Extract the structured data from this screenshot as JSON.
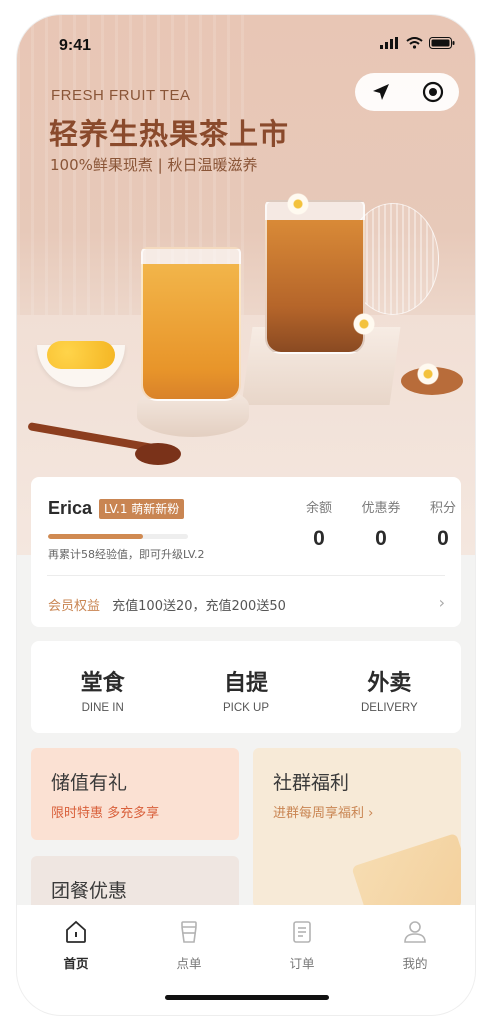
{
  "status": {
    "time": "9:41"
  },
  "hero": {
    "en_title": "FRESH FRUIT TEA",
    "title": "轻养生热果茶上市",
    "subtitle": "100%鲜果现煮 | 秋日温暖滋养"
  },
  "member": {
    "name": "Erica",
    "level": "LV.1 萌新新粉",
    "progress": 0.68,
    "hint": "再累计58经验值，即可升级LV.2",
    "stats": [
      {
        "label": "余额",
        "value": "0"
      },
      {
        "label": "优惠券",
        "value": "0"
      },
      {
        "label": "积分",
        "value": "0"
      }
    ],
    "perk_tag": "会员权益",
    "perk_text": "充值100送20，充值200送50"
  },
  "services": [
    {
      "zh": "堂食",
      "en": "DINE IN"
    },
    {
      "zh": "自提",
      "en": "PICK UP"
    },
    {
      "zh": "外卖",
      "en": "DELIVERY"
    }
  ],
  "promos": {
    "recharge": {
      "title": "储值有礼",
      "sub": "限时特惠 多充多享"
    },
    "group": {
      "title": "社群福利",
      "sub": "进群每周享福利 ›"
    },
    "team": {
      "title": "团餐优惠"
    }
  },
  "tabs": [
    {
      "label": "首页",
      "icon": "home-icon",
      "active": true
    },
    {
      "label": "点单",
      "icon": "cup-icon",
      "active": false
    },
    {
      "label": "订单",
      "icon": "order-icon",
      "active": false
    },
    {
      "label": "我的",
      "icon": "user-icon",
      "active": false
    }
  ],
  "colors": {
    "accent": "#c98552",
    "active_tab": "#2b2b2b",
    "inactive_tab": "#b3b3b3"
  }
}
